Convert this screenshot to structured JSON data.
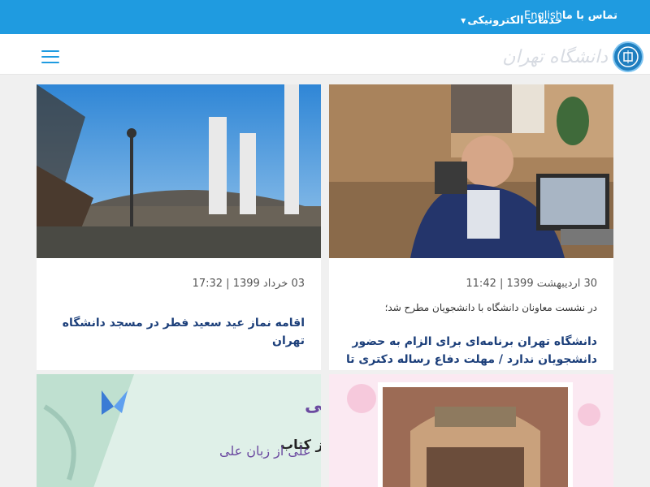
{
  "topbar": {
    "contact": "تماس با ما",
    "english": "English",
    "eservices": "خدمات الکترونیکی"
  },
  "header": {
    "logo_text": "دانشگاه تهران"
  },
  "news": [
    {
      "date": "30 اردیبهشت 1399 | 11:42",
      "lead": "در نشست معاونان دانشگاه با دانشجویان مطرح شد؛",
      "title": "دانشگاه تهران برنامه‌ای برای الزام به حضور دانشجویان ندارد / مهلت دفاع رساله دکتری تا پایان مهر ماه"
    },
    {
      "date": "03 خرداد 1399 | 17:32",
      "title": "اقامه نماز عید سعید فطر در مسجد دانشگاه تهران"
    },
    {
      "image_text_1": "مسابقه بزرگ کتابخوانی",
      "image_text_2": "از کتاب",
      "image_text_3": "علی از زبان علی"
    }
  ],
  "colors": {
    "topbar": "#1f9be0",
    "title": "#1c3f7a"
  }
}
